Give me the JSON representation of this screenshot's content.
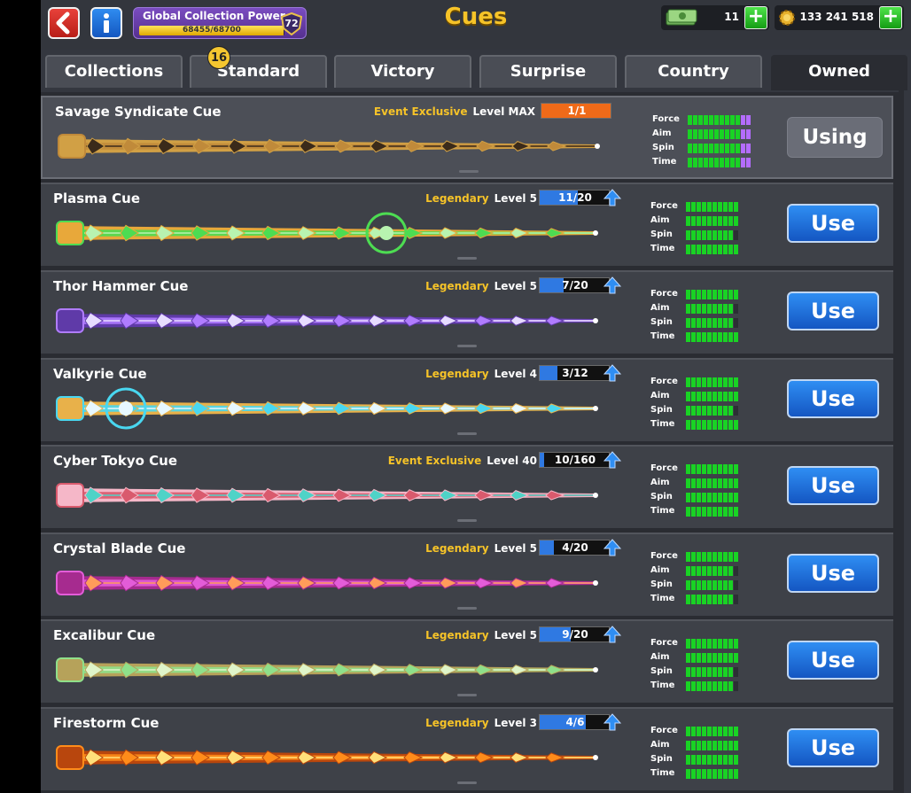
{
  "header": {
    "title": "Cues",
    "collection_power": {
      "label": "Global Collection Power",
      "value": "68455/68700",
      "progress": 0.9964,
      "level": "72"
    },
    "cash": "11",
    "coins": "133 241 518"
  },
  "tabs": [
    {
      "label": "Collections",
      "badge": "16"
    },
    {
      "label": "Standard"
    },
    {
      "label": "Victory"
    },
    {
      "label": "Surprise"
    },
    {
      "label": "Country"
    },
    {
      "label": "Owned",
      "active": true
    }
  ],
  "stat_labels": {
    "force": "Force",
    "aim": "Aim",
    "spin": "Spin",
    "time": "Time"
  },
  "cues": [
    {
      "name": "Savage Syndicate Cue",
      "rarity": "Event Exclusive",
      "level": "Level MAX",
      "progress_text": "1/1",
      "progress": 1.0,
      "max": true,
      "stats": [
        10,
        10,
        10,
        10
      ],
      "purple": [
        2,
        2,
        2,
        2
      ],
      "button": "Using",
      "colors": [
        "#c08a3a",
        "#3a2a1a",
        "#d1a045"
      ]
    },
    {
      "name": "Plasma Cue",
      "rarity": "Legendary",
      "level": "Level 5",
      "progress_text": "11/20",
      "progress": 0.55,
      "stats": [
        10,
        10,
        9,
        10
      ],
      "button": "Use",
      "colors": [
        "#4ddc52",
        "#b8f3b0",
        "#e8a83a"
      ]
    },
    {
      "name": "Thor Hammer Cue",
      "rarity": "Legendary",
      "level": "Level 5",
      "progress_text": "7/20",
      "progress": 0.35,
      "stats": [
        10,
        9,
        9,
        10
      ],
      "button": "Use",
      "colors": [
        "#b07cff",
        "#e7dcff",
        "#5f3aa8"
      ]
    },
    {
      "name": "Valkyrie Cue",
      "rarity": "Legendary",
      "level": "Level 4",
      "progress_text": "3/12",
      "progress": 0.25,
      "stats": [
        10,
        10,
        9,
        10
      ],
      "button": "Use",
      "colors": [
        "#49d7f0",
        "#e7f8ff",
        "#e8b14a"
      ]
    },
    {
      "name": "Cyber Tokyo Cue",
      "rarity": "Event Exclusive",
      "level": "Level 40",
      "progress_text": "10/160",
      "progress": 0.06,
      "stats": [
        10,
        10,
        10,
        10
      ],
      "button": "Use",
      "colors": [
        "#d95a6d",
        "#4fd3c7",
        "#f5b7c8"
      ]
    },
    {
      "name": "Crystal Blade Cue",
      "rarity": "Legendary",
      "level": "Level 5",
      "progress_text": "4/20",
      "progress": 0.2,
      "stats": [
        10,
        9,
        9,
        9
      ],
      "button": "Use",
      "colors": [
        "#e35cd8",
        "#ff9c5a",
        "#a62b8f"
      ]
    },
    {
      "name": "Excalibur Cue",
      "rarity": "Legendary",
      "level": "Level 5",
      "progress_text": "9/20",
      "progress": 0.45,
      "stats": [
        10,
        10,
        9,
        9
      ],
      "button": "Use",
      "colors": [
        "#8fe08a",
        "#dff5c9",
        "#b6a25a"
      ]
    },
    {
      "name": "Firestorm Cue",
      "rarity": "Legendary",
      "level": "Level 3",
      "progress_text": "4/6",
      "progress": 0.67,
      "stats": [
        10,
        10,
        10,
        10
      ],
      "button": "Use",
      "colors": [
        "#ff8c1a",
        "#ffe07a",
        "#b8460d"
      ]
    }
  ]
}
